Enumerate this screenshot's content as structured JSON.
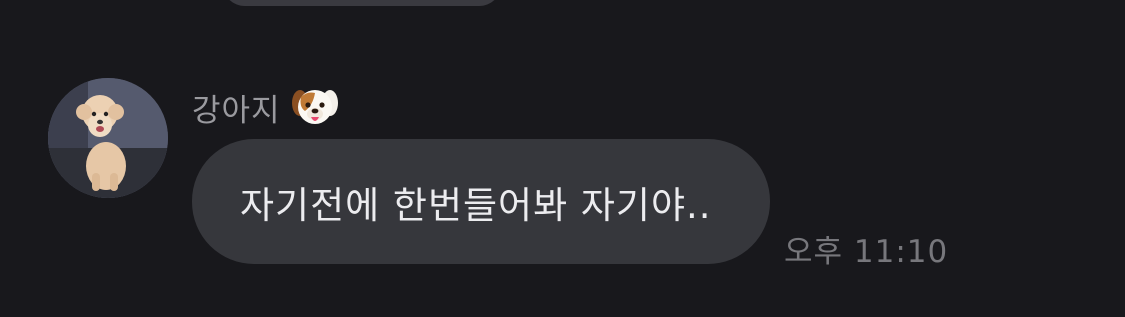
{
  "message": {
    "sender_name": "강아지",
    "sender_emoji_icon": "dog-face-icon",
    "text": "자기전에 한번들어봐 자기야..",
    "time": "오후 11:10",
    "avatar_icon": "dog-photo-avatar"
  },
  "colors": {
    "background": "#18181c",
    "bubble": "#36373c",
    "text": "#ececef",
    "muted": "#9a9a9f"
  }
}
